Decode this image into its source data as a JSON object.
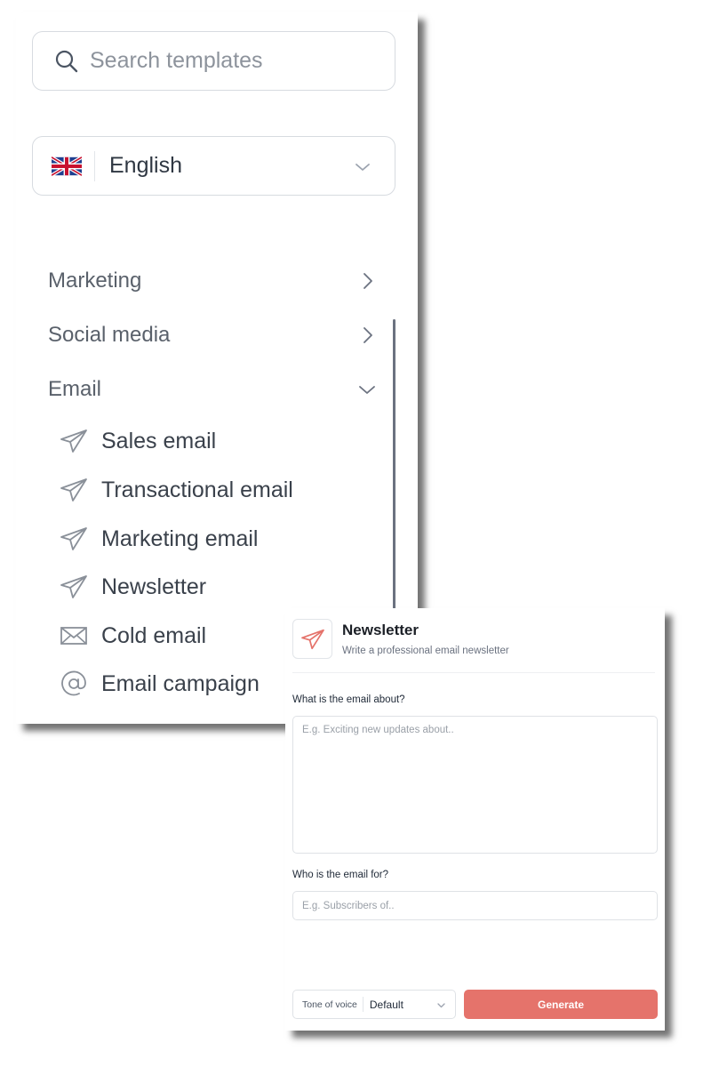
{
  "sidebar": {
    "search": {
      "placeholder": "Search templates",
      "icon": "search-icon"
    },
    "language": {
      "label": "English",
      "flag": "uk-flag-icon"
    },
    "categories": [
      {
        "label": "Marketing",
        "state": "collapsed"
      },
      {
        "label": "Social media",
        "state": "collapsed"
      },
      {
        "label": "Email",
        "state": "expanded"
      }
    ],
    "email_templates": [
      {
        "label": "Sales email",
        "icon": "paper-plane-icon"
      },
      {
        "label": "Transactional email",
        "icon": "paper-plane-icon"
      },
      {
        "label": "Marketing email",
        "icon": "paper-plane-icon"
      },
      {
        "label": "Newsletter",
        "icon": "paper-plane-icon"
      },
      {
        "label": "Cold email",
        "icon": "envelope-icon"
      },
      {
        "label": "Email campaign",
        "icon": "at-sign-icon"
      }
    ]
  },
  "form": {
    "title": "Newsletter",
    "subtitle": "Write a professional email newsletter",
    "icon": "paper-plane-icon",
    "accent_color": "#e5736b",
    "about": {
      "label": "What is the email about?",
      "placeholder": "E.g. Exciting new updates about.."
    },
    "audience": {
      "label": "Who is the email for?",
      "placeholder": "E.g. Subscribers of.."
    },
    "tone": {
      "label": "Tone of voice",
      "value": "Default"
    },
    "generate_label": "Generate"
  }
}
